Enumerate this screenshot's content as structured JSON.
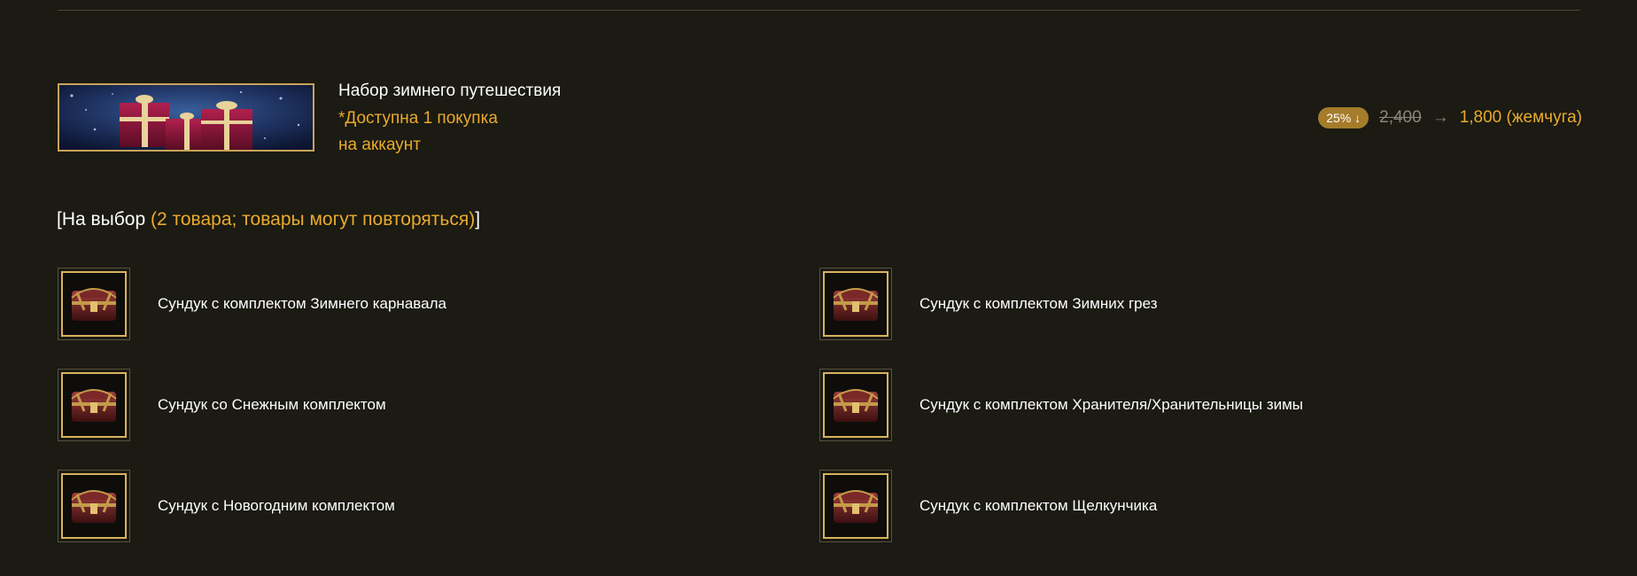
{
  "package": {
    "title": "Набор зимнего путешествия",
    "limit_line1": "*Доступна 1 покупка",
    "limit_line2": "на аккаунт",
    "banner_icon": "gift-boxes-banner"
  },
  "price": {
    "discount": "25% ↓",
    "old": "2,400",
    "arrow": "→",
    "new": "1,800 (жемчуга)"
  },
  "choice": {
    "prefix": "[На выбор ",
    "highlight": "(2 товара; товары могут повторяться)",
    "suffix": "]"
  },
  "items": [
    {
      "label": "Сундук с комплектом Зимнего карнавала",
      "icon": "chest-icon"
    },
    {
      "label": "Сундук с комплектом Зимних грез",
      "icon": "chest-icon"
    },
    {
      "label": "Сундук со Снежным комплектом",
      "icon": "chest-icon"
    },
    {
      "label": "Сундук с комплектом Хранителя/Хранительницы зимы",
      "icon": "chest-icon"
    },
    {
      "label": "Сундук с Новогодним комплектом",
      "icon": "chest-icon"
    },
    {
      "label": "Сундук с комплектом Щелкунчика",
      "icon": "chest-icon"
    }
  ],
  "colors": {
    "background": "#1b1a13",
    "accent": "#e9ab2c",
    "frame": "#c9a35a",
    "badge": "#a47c2b"
  }
}
